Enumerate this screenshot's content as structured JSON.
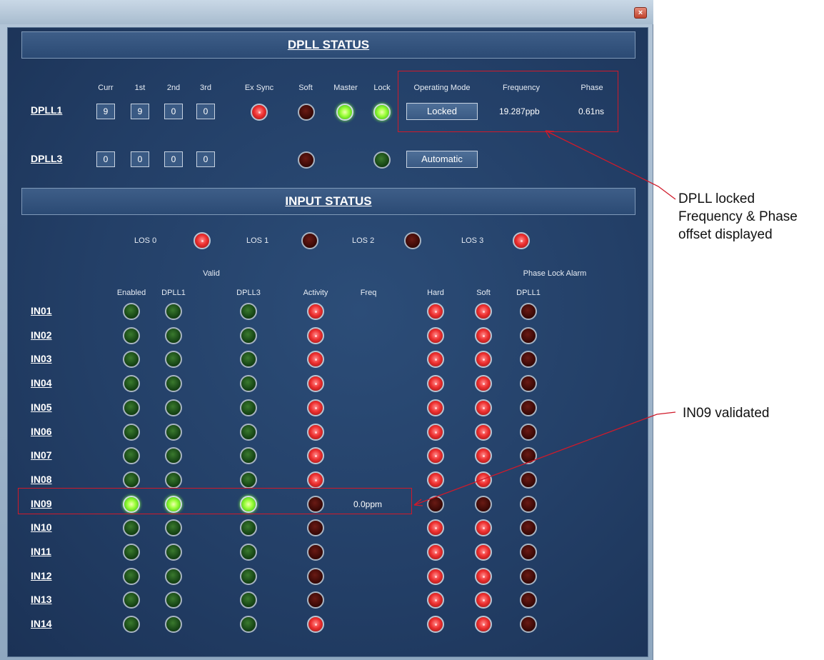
{
  "dpll_status": {
    "title": "DPLL STATUS",
    "columns": {
      "curr": "Curr",
      "first": "1st",
      "second": "2nd",
      "third": "3rd",
      "ex_sync": "Ex Sync",
      "soft": "Soft",
      "master": "Master",
      "lock": "Lock",
      "operating_mode": "Operating Mode",
      "frequency": "Frequency",
      "phase": "Phase"
    },
    "rows": [
      {
        "name": "DPLL1",
        "curr": "9",
        "first": "9",
        "second": "0",
        "third": "0",
        "ex_sync": "red",
        "soft": "off-red",
        "master": "green",
        "lock": "green",
        "mode": "Locked",
        "frequency": "19.287ppb",
        "phase": "0.61ns"
      },
      {
        "name": "DPLL3",
        "curr": "0",
        "first": "0",
        "second": "0",
        "third": "0",
        "soft": "off-red",
        "lock": "off-green",
        "mode": "Automatic"
      }
    ]
  },
  "input_status": {
    "title": "INPUT STATUS",
    "los": [
      {
        "label": "LOS 0",
        "state": "red"
      },
      {
        "label": "LOS 1",
        "state": "off-red"
      },
      {
        "label": "LOS 2",
        "state": "off-red"
      },
      {
        "label": "LOS 3",
        "state": "red"
      }
    ],
    "group_headers": {
      "valid": "Valid",
      "phase_lock_alarm": "Phase Lock Alarm"
    },
    "columns": {
      "enabled": "Enabled",
      "valid_dpll1": "DPLL1",
      "valid_dpll3": "DPLL3",
      "activity": "Activity",
      "freq": "Freq",
      "hard": "Hard",
      "soft": "Soft",
      "alarm_dpll1": "DPLL1"
    },
    "rows": [
      {
        "name": "IN01",
        "enabled": "off-green",
        "valid_dpll1": "off-green",
        "valid_dpll3": "off-green",
        "activity": "red",
        "freq": "",
        "hard": "red",
        "soft": "red",
        "alarm_dpll1": "off-red"
      },
      {
        "name": "IN02",
        "enabled": "off-green",
        "valid_dpll1": "off-green",
        "valid_dpll3": "off-green",
        "activity": "red",
        "freq": "",
        "hard": "red",
        "soft": "red",
        "alarm_dpll1": "off-red"
      },
      {
        "name": "IN03",
        "enabled": "off-green",
        "valid_dpll1": "off-green",
        "valid_dpll3": "off-green",
        "activity": "red",
        "freq": "",
        "hard": "red",
        "soft": "red",
        "alarm_dpll1": "off-red"
      },
      {
        "name": "IN04",
        "enabled": "off-green",
        "valid_dpll1": "off-green",
        "valid_dpll3": "off-green",
        "activity": "red",
        "freq": "",
        "hard": "red",
        "soft": "red",
        "alarm_dpll1": "off-red"
      },
      {
        "name": "IN05",
        "enabled": "off-green",
        "valid_dpll1": "off-green",
        "valid_dpll3": "off-green",
        "activity": "red",
        "freq": "",
        "hard": "red",
        "soft": "red",
        "alarm_dpll1": "off-red"
      },
      {
        "name": "IN06",
        "enabled": "off-green",
        "valid_dpll1": "off-green",
        "valid_dpll3": "off-green",
        "activity": "red",
        "freq": "",
        "hard": "red",
        "soft": "red",
        "alarm_dpll1": "off-red"
      },
      {
        "name": "IN07",
        "enabled": "off-green",
        "valid_dpll1": "off-green",
        "valid_dpll3": "off-green",
        "activity": "red",
        "freq": "",
        "hard": "red",
        "soft": "red",
        "alarm_dpll1": "off-red"
      },
      {
        "name": "IN08",
        "enabled": "off-green",
        "valid_dpll1": "off-green",
        "valid_dpll3": "off-green",
        "activity": "red",
        "freq": "",
        "hard": "red",
        "soft": "red",
        "alarm_dpll1": "off-red"
      },
      {
        "name": "IN09",
        "enabled": "green",
        "valid_dpll1": "green",
        "valid_dpll3": "green",
        "activity": "off-red",
        "freq": "0.0ppm",
        "hard": "off-red",
        "soft": "off-red",
        "alarm_dpll1": "off-red"
      },
      {
        "name": "IN10",
        "enabled": "off-green",
        "valid_dpll1": "off-green",
        "valid_dpll3": "off-green",
        "activity": "off-red",
        "freq": "",
        "hard": "red",
        "soft": "red",
        "alarm_dpll1": "off-red"
      },
      {
        "name": "IN11",
        "enabled": "off-green",
        "valid_dpll1": "off-green",
        "valid_dpll3": "off-green",
        "activity": "off-red",
        "freq": "",
        "hard": "red",
        "soft": "red",
        "alarm_dpll1": "off-red"
      },
      {
        "name": "IN12",
        "enabled": "off-green",
        "valid_dpll1": "off-green",
        "valid_dpll3": "off-green",
        "activity": "off-red",
        "freq": "",
        "hard": "red",
        "soft": "red",
        "alarm_dpll1": "off-red"
      },
      {
        "name": "IN13",
        "enabled": "off-green",
        "valid_dpll1": "off-green",
        "valid_dpll3": "off-green",
        "activity": "off-red",
        "freq": "",
        "hard": "red",
        "soft": "red",
        "alarm_dpll1": "off-red"
      },
      {
        "name": "IN14",
        "enabled": "off-green",
        "valid_dpll1": "off-green",
        "valid_dpll3": "off-green",
        "activity": "red",
        "freq": "",
        "hard": "red",
        "soft": "red",
        "alarm_dpll1": "off-red"
      }
    ]
  },
  "annotations": {
    "dpll_locked": [
      "DPLL locked",
      "Frequency & Phase",
      "offset displayed"
    ],
    "in09_validated": "IN09 validated"
  },
  "window": {
    "close_icon": "close-icon"
  },
  "colors": {
    "panel_bg": "#233f67",
    "led_red": "#ee2f2f",
    "led_green": "#9cff3a",
    "led_off_red": "#3d0a07",
    "led_off_green": "#174616",
    "annotation": "#d01a2a"
  }
}
